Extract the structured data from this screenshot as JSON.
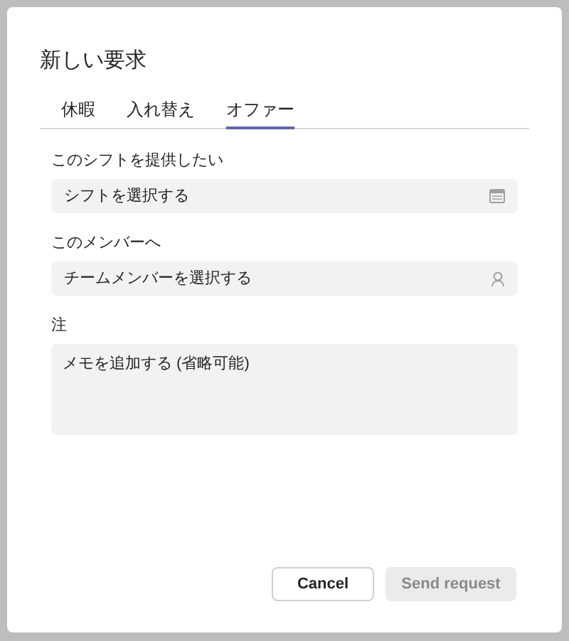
{
  "dialog": {
    "title": "新しい要求"
  },
  "tabs": [
    {
      "label": "休暇",
      "selected": false
    },
    {
      "label": "入れ替え",
      "selected": false
    },
    {
      "label": "オファー",
      "selected": true
    }
  ],
  "fields": [
    {
      "label": "このシフトを提供したい",
      "placeholder": "シフトを選択する",
      "kind": "calendar"
    },
    {
      "label": "このメンバーへ",
      "placeholder": "チームメンバーを選択する",
      "kind": "person"
    },
    {
      "label": "注",
      "placeholder": "メモを追加する (省略可能)",
      "kind": "note"
    }
  ],
  "buttons": [
    {
      "label": "Cancel",
      "disabled": false
    },
    {
      "label": "Send request",
      "disabled": true
    }
  ]
}
